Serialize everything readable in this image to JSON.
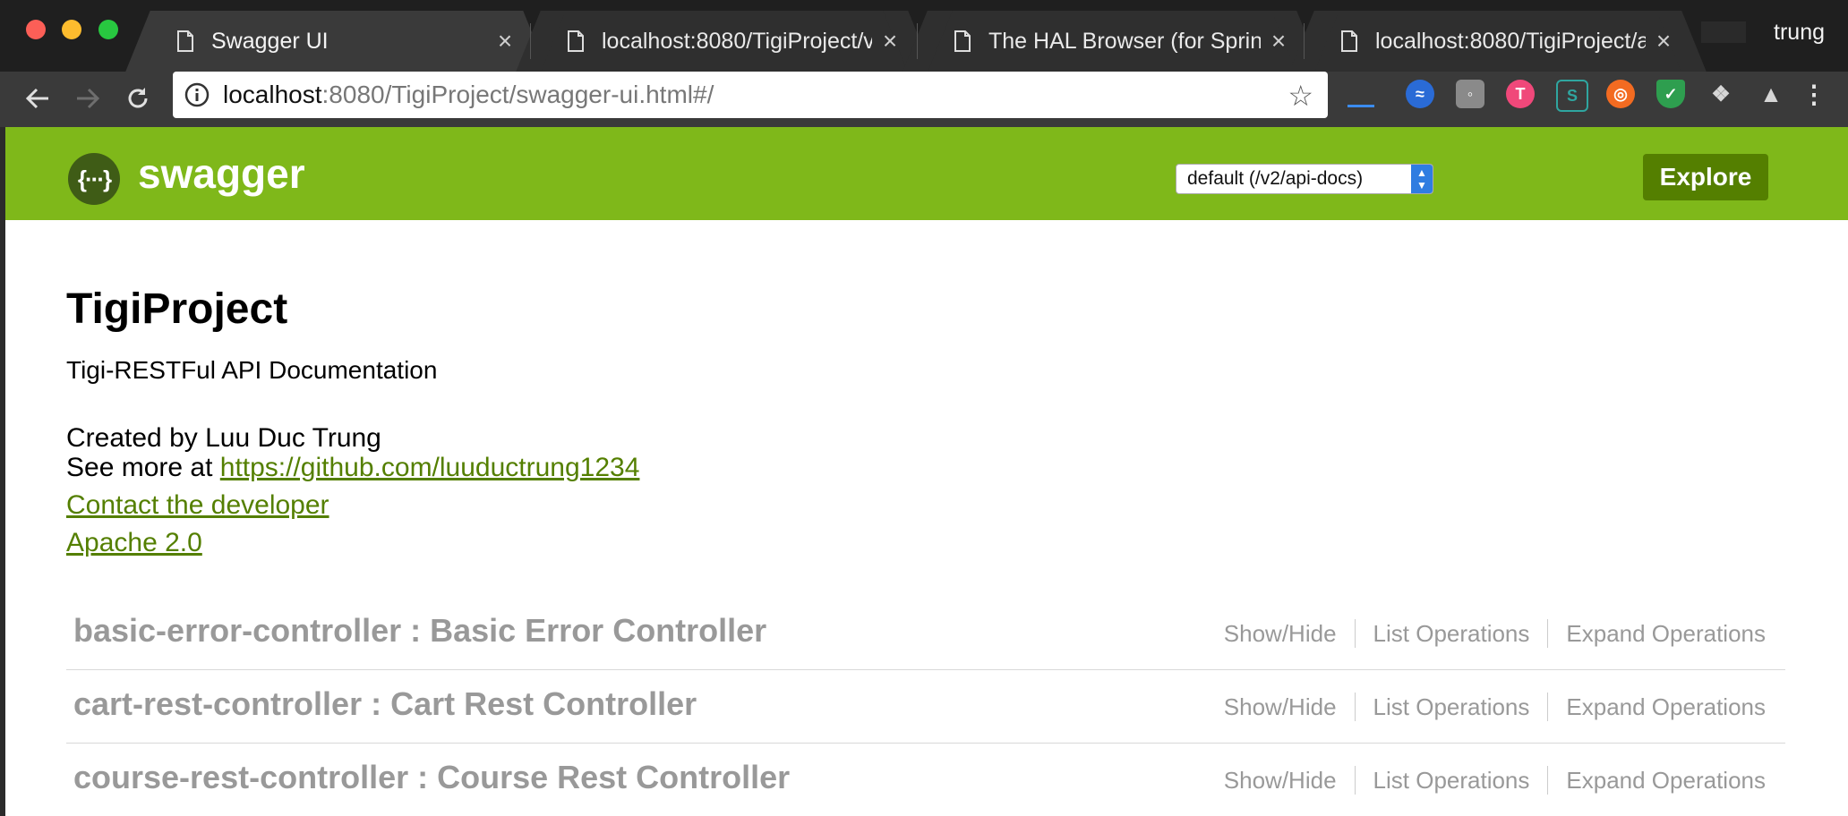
{
  "browser": {
    "tabs": [
      {
        "label": "Swagger UI",
        "active": true
      },
      {
        "label": "localhost:8080/TigiProject/v",
        "active": false
      },
      {
        "label": "The HAL Browser (for Spring",
        "active": false
      },
      {
        "label": "localhost:8080/TigiProject/a",
        "active": false
      }
    ],
    "close_glyph": "×",
    "profile_name": "trung",
    "url_host": "localhost",
    "url_path": ":8080/TigiProject/swagger-ui.html#/",
    "extensions": [
      "underline-ext-icon",
      "sync-ext-icon",
      "bulb-ext-icon",
      "t-ext-icon",
      "s-ext-icon",
      "ubuntu-ext-icon",
      "shield-ext-icon",
      "dropbox-ext-icon",
      "drive-ext-icon",
      "menu-dots-icon"
    ]
  },
  "swagger": {
    "brand": "swagger",
    "logo_glyph": "{···}",
    "spec_select": "default (/v2/api-docs)",
    "explore_label": "Explore",
    "accent_color": "#7fb81a"
  },
  "info": {
    "title": "TigiProject",
    "description": "Tigi-RESTFul API Documentation",
    "created_by": "Created by Luu Duc Trung",
    "see_more_prefix": "See more at ",
    "see_more_link": "https://github.com/luuductrung1234",
    "contact_link": "Contact the developer",
    "license_link": "Apache 2.0"
  },
  "resources": [
    {
      "name": "basic-error-controller : Basic Error Controller"
    },
    {
      "name": "cart-rest-controller : Cart Rest Controller"
    },
    {
      "name": "course-rest-controller : Course Rest Controller"
    }
  ],
  "resource_ops": {
    "show_hide": "Show/Hide",
    "list_operations": "List Operations",
    "expand_operations": "Expand Operations"
  }
}
